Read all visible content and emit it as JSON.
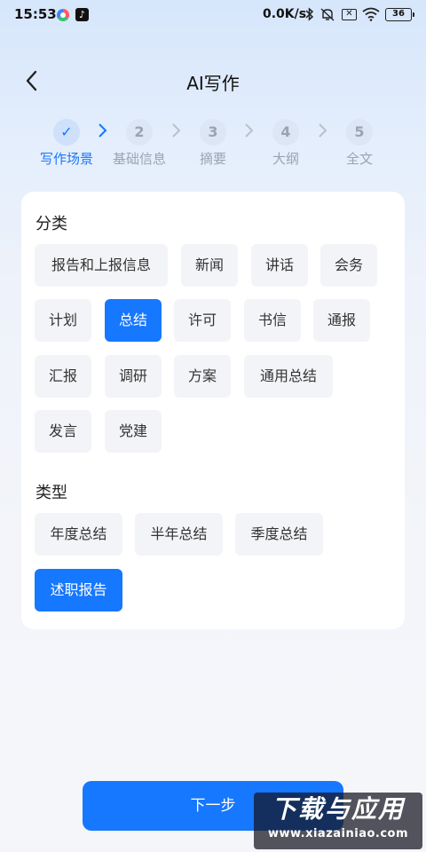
{
  "status_bar": {
    "time": "15:53",
    "app_icon_2": "♪",
    "net_speed": "0.0K/s",
    "sim_icon": "✕",
    "battery": "36"
  },
  "header": {
    "title": "AI写作"
  },
  "stepper": {
    "steps": [
      {
        "number": "✓",
        "label": "写作场景",
        "active": true
      },
      {
        "number": "2",
        "label": "基础信息",
        "active": false
      },
      {
        "number": "3",
        "label": "摘要",
        "active": false
      },
      {
        "number": "4",
        "label": "大纲",
        "active": false
      },
      {
        "number": "5",
        "label": "全文",
        "active": false
      }
    ]
  },
  "category": {
    "title": "分类",
    "options": [
      "报告和上报信息",
      "新闻",
      "讲话",
      "会务",
      "计划",
      "总结",
      "许可",
      "书信",
      "通报",
      "汇报",
      "调研",
      "方案",
      "通用总结",
      "发言",
      "党建"
    ],
    "selected": "总结"
  },
  "type": {
    "title": "类型",
    "options": [
      "年度总结",
      "半年总结",
      "季度总结",
      "述职报告"
    ],
    "selected": "述职报告"
  },
  "footer": {
    "next_label": "下一步"
  },
  "watermark": {
    "main": "下载与应用",
    "sub": "www.xiazainiao.com"
  },
  "colors": {
    "accent": "#1677ff",
    "chip_bg": "#f3f4f7",
    "inactive_step": "#9aa3b2"
  }
}
